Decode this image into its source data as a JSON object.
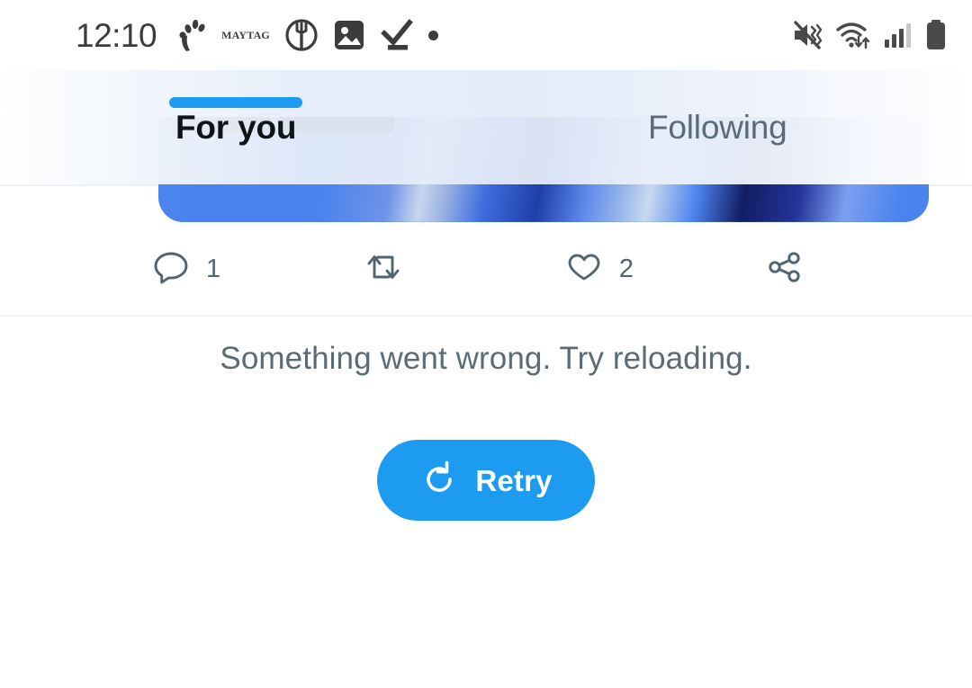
{
  "status_bar": {
    "time": "12:10",
    "notification_icons": [
      {
        "name": "hand-gesture-icon",
        "label": "hand"
      },
      {
        "name": "maytag-logo-icon",
        "label": "MAYTAG"
      },
      {
        "name": "restaurant-fork-icon",
        "label": "fork in circle"
      },
      {
        "name": "gallery-photo-icon",
        "label": "photo"
      },
      {
        "name": "checkmark-underline-icon",
        "label": "check"
      },
      {
        "name": "dot-notification-icon",
        "label": "dot"
      }
    ],
    "system_icons": [
      {
        "name": "mute-vibrate-icon",
        "label": "sound off"
      },
      {
        "name": "wifi-transfer-icon",
        "label": "wifi"
      },
      {
        "name": "cellular-signal-icon",
        "label": "signal"
      },
      {
        "name": "battery-full-icon",
        "label": "battery"
      }
    ]
  },
  "tabs": {
    "for_you": "For you",
    "following": "Following",
    "active": "For you"
  },
  "tweet": {
    "actions": {
      "reply_count": "1",
      "retweet_count": "",
      "like_count": "2",
      "share_count": ""
    }
  },
  "error": {
    "message": "Something went wrong. Try reloading.",
    "retry_label": "Retry"
  },
  "colors": {
    "accent": "#1D9BF0",
    "secondary_text": "#536471",
    "error_text": "#5B6B76",
    "active_tab_text": "#0F1419",
    "inactive_tab_text": "#5A6B78"
  }
}
